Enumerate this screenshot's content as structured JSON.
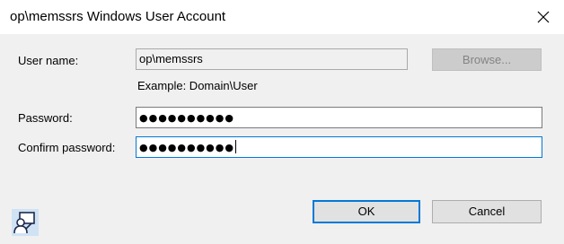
{
  "window": {
    "title": "op\\memssrs Windows User Account",
    "close_glyph": "✕"
  },
  "form": {
    "username_label": "User name:",
    "username_value": "op\\memssrs",
    "browse_label": "Browse...",
    "example_text": "Example: Domain\\User",
    "password_label": "Password:",
    "password_mask": "●●●●●●●●●●",
    "confirm_label": "Confirm password:",
    "confirm_mask": "●●●●●●●●●●"
  },
  "buttons": {
    "ok_label": "OK",
    "cancel_label": "Cancel"
  },
  "icons": {
    "close": "close-icon",
    "account": "user-account-icon"
  },
  "colors": {
    "dialog_bg": "#f0f0f0",
    "focus_border": "#0078d7"
  }
}
